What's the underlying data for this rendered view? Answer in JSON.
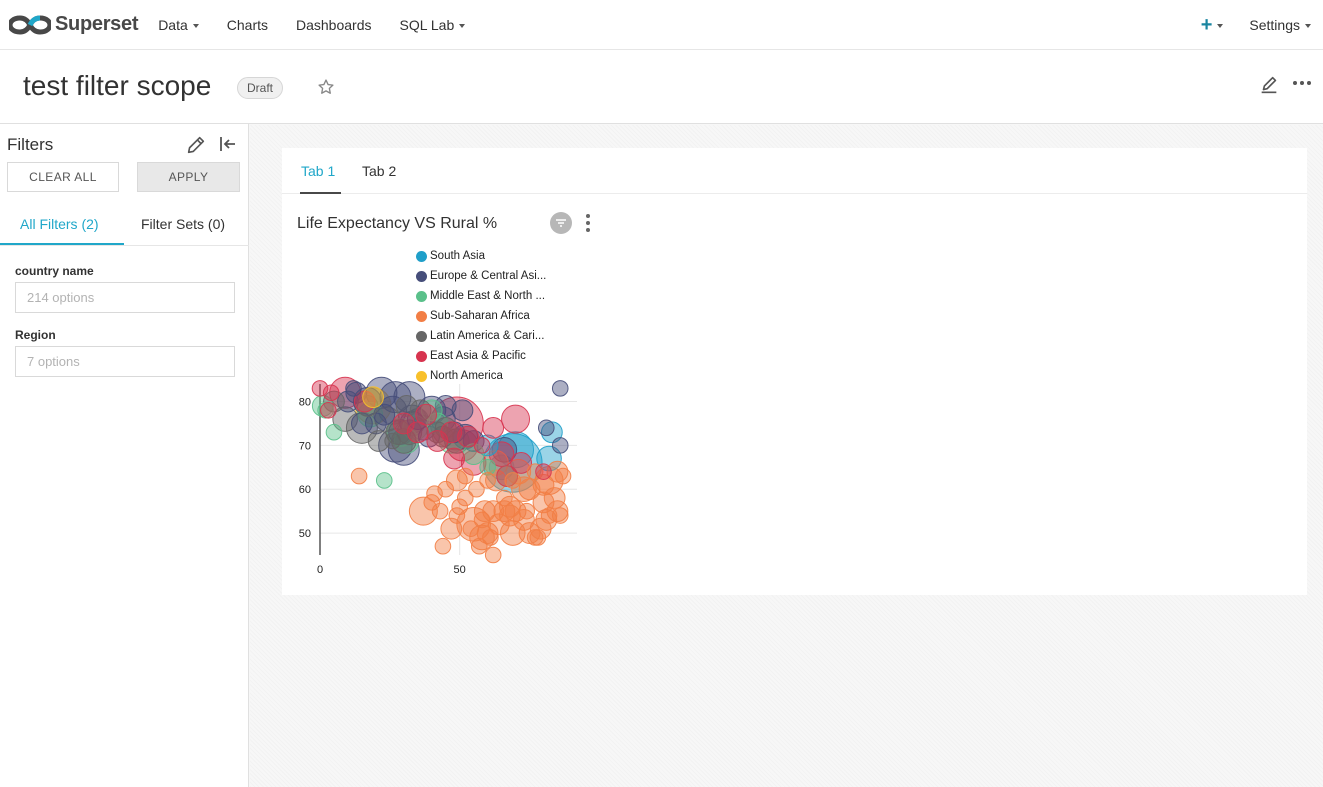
{
  "nav": {
    "brand": "Superset",
    "items": [
      {
        "label": "Data",
        "has_caret": true
      },
      {
        "label": "Charts",
        "has_caret": false
      },
      {
        "label": "Dashboards",
        "has_caret": false
      },
      {
        "label": "SQL Lab",
        "has_caret": true
      }
    ],
    "plus_icon": "plus-icon",
    "settings_label": "Settings"
  },
  "dashboard": {
    "title": "test filter scope",
    "status_badge": "Draft",
    "icons": [
      "star-icon",
      "pencil-icon",
      "more-horizontal-icon"
    ]
  },
  "filters": {
    "title": "Filters",
    "clear_all": "CLEAR ALL",
    "apply": "APPLY",
    "tabs": [
      {
        "label": "All Filters (2)",
        "active": true
      },
      {
        "label": "Filter Sets (0)",
        "active": false
      }
    ],
    "fields": [
      {
        "label": "country name",
        "placeholder": "214 options"
      },
      {
        "label": "Region",
        "placeholder": "7 options"
      }
    ]
  },
  "tabs": [
    {
      "label": "Tab 1",
      "active": true
    },
    {
      "label": "Tab 2",
      "active": false
    }
  ],
  "chart": {
    "title": "Life Expectancy VS Rural %",
    "colors": {
      "accent": "#20a7c9",
      "South Asia": "#1f9fc9",
      "Europe & Central Asia": "#464e7a",
      "Middle East & North Africa": "#5ac08a",
      "Sub-Saharan Africa": "#f27e45",
      "Latin America & Caribbean": "#666666",
      "East Asia & Pacific": "#d7344f",
      "North America": "#f8c02b"
    }
  },
  "chart_data": {
    "type": "scatter",
    "title": "Life Expectancy VS Rural %",
    "xlabel": "",
    "ylabel": "",
    "xlim": [
      0,
      92
    ],
    "ylim": [
      45,
      84
    ],
    "x_ticks": [
      "0",
      "50"
    ],
    "y_ticks": [
      "50",
      "60",
      "70",
      "80"
    ],
    "legend_placement": "top",
    "legend_entries": [
      "South Asia",
      "Europe & Central Asi...",
      "Middle East & North ...",
      "Sub-Saharan Africa",
      "Latin America & Cari...",
      "East Asia & Pacific",
      "North America"
    ],
    "series": [
      {
        "name": "South Asia",
        "points": [
          [
            69,
            66,
            20
          ],
          [
            70,
            69,
            7
          ],
          [
            82,
            67,
            3
          ],
          [
            65,
            65,
            3
          ],
          [
            83,
            73,
            2
          ],
          [
            60,
            70,
            2
          ]
        ]
      },
      {
        "name": "Europe & Central Asia",
        "points": [
          [
            22,
            82,
            5
          ],
          [
            27,
            81,
            5
          ],
          [
            32,
            81,
            5
          ],
          [
            17,
            80,
            4
          ],
          [
            26,
            78,
            4
          ],
          [
            33,
            76,
            4
          ],
          [
            40,
            78,
            4
          ],
          [
            44,
            76,
            3
          ],
          [
            37,
            74,
            3
          ],
          [
            52,
            72,
            3
          ],
          [
            66,
            69,
            3
          ],
          [
            27,
            70,
            6
          ],
          [
            30,
            69,
            5
          ],
          [
            35,
            76,
            2
          ],
          [
            39,
            72,
            2
          ],
          [
            48,
            73,
            2
          ],
          [
            10,
            80,
            2
          ],
          [
            13,
            82,
            2
          ],
          [
            20,
            75,
            2
          ],
          [
            29,
            73,
            3
          ],
          [
            33,
            75,
            3
          ],
          [
            23,
            77,
            2
          ],
          [
            45,
            79,
            2
          ],
          [
            15,
            75,
            2
          ],
          [
            51,
            78,
            2
          ],
          [
            55,
            71,
            2
          ],
          [
            86,
            70,
            1
          ],
          [
            81,
            74,
            1
          ],
          [
            86,
            83,
            1
          ],
          [
            12,
            83,
            1
          ]
        ]
      },
      {
        "name": "Middle East & North Africa",
        "points": [
          [
            18,
            77,
            3
          ],
          [
            29,
            73,
            4
          ],
          [
            34,
            74,
            3
          ],
          [
            31,
            71,
            3
          ],
          [
            1,
            79,
            2
          ],
          [
            2,
            78,
            1
          ],
          [
            40,
            78,
            2
          ],
          [
            42,
            75,
            2
          ],
          [
            47,
            71,
            3
          ],
          [
            55,
            68,
            2
          ],
          [
            67,
            63,
            2
          ],
          [
            5,
            73,
            1
          ],
          [
            23,
            62,
            1
          ],
          [
            60,
            65,
            1
          ]
        ]
      },
      {
        "name": "Sub-Saharan Africa",
        "points": [
          [
            55,
            52,
            6
          ],
          [
            63,
            66,
            3
          ],
          [
            82,
            62,
            4
          ],
          [
            73,
            60,
            3
          ],
          [
            71,
            64,
            3
          ],
          [
            75,
            60,
            2
          ],
          [
            63,
            62,
            2
          ],
          [
            59,
            55,
            2
          ],
          [
            62,
            55,
            2
          ],
          [
            66,
            55,
            2
          ],
          [
            68,
            56,
            2
          ],
          [
            70,
            55,
            2
          ],
          [
            73,
            53,
            2
          ],
          [
            75,
            50,
            2
          ],
          [
            79,
            51,
            2
          ],
          [
            81,
            53,
            2
          ],
          [
            80,
            57,
            2
          ],
          [
            84,
            58,
            2
          ],
          [
            85,
            55,
            2
          ],
          [
            58,
            49,
            3
          ],
          [
            60,
            50,
            2
          ],
          [
            64,
            52,
            2
          ],
          [
            68,
            54,
            2
          ],
          [
            69,
            50,
            3
          ],
          [
            74,
            55,
            1
          ],
          [
            78,
            49,
            1
          ],
          [
            86,
            54,
            1
          ],
          [
            82,
            54,
            1
          ],
          [
            37,
            55,
            4
          ],
          [
            47,
            51,
            2
          ],
          [
            49,
            54,
            1
          ],
          [
            50,
            56,
            1
          ],
          [
            45,
            60,
            1
          ],
          [
            49,
            62,
            2
          ],
          [
            52,
            63,
            1
          ],
          [
            56,
            60,
            1
          ],
          [
            41,
            59,
            1
          ],
          [
            40,
            57,
            1
          ],
          [
            43,
            55,
            1
          ],
          [
            58,
            53,
            1
          ],
          [
            66,
            58,
            1
          ],
          [
            69,
            62,
            1
          ],
          [
            77,
            64,
            1
          ],
          [
            85,
            64,
            2
          ],
          [
            87,
            63,
            1
          ],
          [
            61,
            49,
            1
          ],
          [
            44,
            47,
            1
          ],
          [
            54,
            51,
            1
          ],
          [
            80,
            61,
            2
          ],
          [
            77,
            49,
            1
          ],
          [
            62,
            45,
            1
          ],
          [
            57,
            47,
            1
          ],
          [
            52,
            58,
            1
          ],
          [
            60,
            62,
            1
          ],
          [
            14,
            63,
            1
          ]
        ]
      },
      {
        "name": "Latin America & Caribbean",
        "points": [
          [
            15,
            74,
            5
          ],
          [
            9,
            76,
            3
          ],
          [
            24,
            76,
            3
          ],
          [
            32,
            73,
            3
          ],
          [
            28,
            73,
            3
          ],
          [
            17,
            79,
            2
          ],
          [
            30,
            71,
            3
          ],
          [
            5,
            80,
            2
          ],
          [
            31,
            79,
            2
          ],
          [
            44,
            72,
            2
          ],
          [
            49,
            71,
            3
          ],
          [
            42,
            73,
            2
          ],
          [
            21,
            71,
            2
          ],
          [
            26,
            71,
            1
          ],
          [
            36,
            78,
            2
          ],
          [
            45,
            74,
            2
          ]
        ]
      },
      {
        "name": "East Asia & Pacific",
        "points": [
          [
            49,
            75,
            16
          ],
          [
            9,
            82,
            5
          ],
          [
            55,
            66,
            3
          ],
          [
            51,
            70,
            5
          ],
          [
            47,
            73,
            2
          ],
          [
            70,
            76,
            4
          ],
          [
            65,
            68,
            3
          ],
          [
            62,
            74,
            2
          ],
          [
            42,
            71,
            2
          ],
          [
            38,
            77,
            2
          ],
          [
            0,
            83,
            1
          ],
          [
            4,
            82,
            1
          ],
          [
            3,
            78,
            1
          ],
          [
            16,
            80,
            2
          ],
          [
            30,
            75,
            2
          ],
          [
            53,
            72,
            2
          ],
          [
            48,
            67,
            2
          ],
          [
            67,
            63,
            2
          ],
          [
            72,
            66,
            2
          ],
          [
            80,
            64,
            1
          ],
          [
            58,
            70,
            1
          ],
          [
            35,
            73,
            2
          ]
        ]
      },
      {
        "name": "North America",
        "points": [
          [
            19,
            79,
            7
          ],
          [
            19,
            81,
            2
          ]
        ]
      }
    ]
  }
}
